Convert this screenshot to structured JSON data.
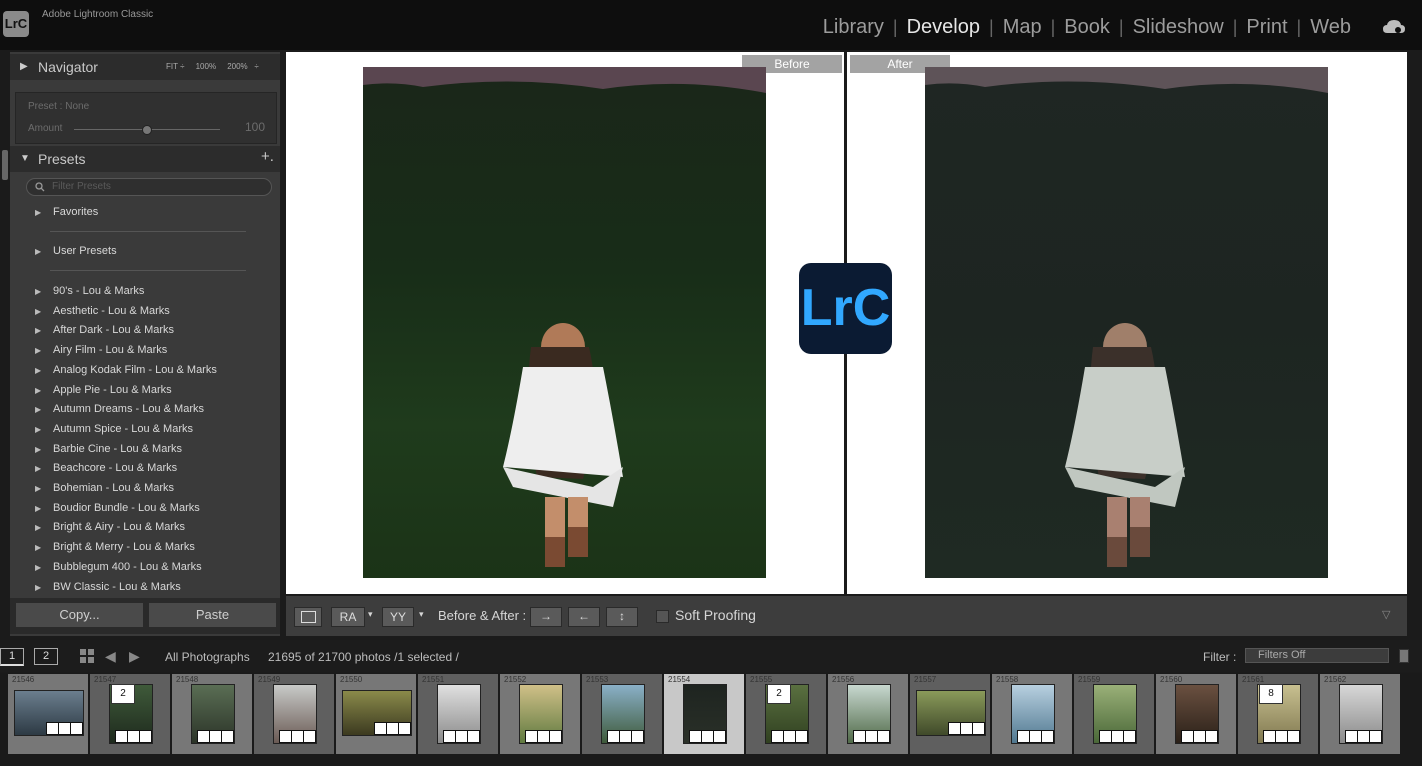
{
  "app": {
    "logo": "LrC",
    "name": "Adobe Lightroom Classic"
  },
  "modules": [
    {
      "label": "Library",
      "active": false
    },
    {
      "label": "Develop",
      "active": true
    },
    {
      "label": "Map",
      "active": false
    },
    {
      "label": "Book",
      "active": false
    },
    {
      "label": "Slideshow",
      "active": false
    },
    {
      "label": "Print",
      "active": false
    },
    {
      "label": "Web",
      "active": false
    }
  ],
  "navigator": {
    "title": "Navigator",
    "zoom": [
      "FIT ÷",
      "100%",
      "200%",
      "÷"
    ]
  },
  "preset_info": {
    "preset_label": "Preset : None",
    "amount_label": "Amount",
    "amount_value": "100",
    "amount_fraction": 0.5
  },
  "presets": {
    "title": "Presets",
    "add": "+.",
    "filter_placeholder": "Filter Presets",
    "groups": [
      "Favorites",
      "User Presets"
    ],
    "items": [
      "90's - Lou & Marks",
      "Aesthetic - Lou & Marks",
      "After Dark - Lou & Marks",
      "Airy Film - Lou & Marks",
      "Analog Kodak Film - Lou & Marks",
      "Apple Pie - Lou & Marks",
      "Autumn Dreams - Lou & Marks",
      "Autumn Spice - Lou & Marks",
      "Barbie Cine - Lou & Marks",
      "Beachcore - Lou & Marks",
      "Bohemian - Lou & Marks",
      "Boudior Bundle - Lou & Marks",
      "Bright & Airy - Lou & Marks",
      "Bright & Merry - Lou & Marks",
      "Bubblegum 400 - Lou & Marks",
      "BW Classic - Lou & Marks"
    ]
  },
  "left_buttons": {
    "copy": "Copy...",
    "paste": "Paste"
  },
  "viewer": {
    "before": "Before",
    "after": "After",
    "badge": "LrC"
  },
  "toolbar": {
    "ba_icon": "RA",
    "yy_icon": "YY",
    "before_after": "Before & After :",
    "soft_proofing": "Soft Proofing"
  },
  "filmstrip_bar": {
    "page1": "1",
    "page2": "2",
    "source": "All Photographs",
    "count": "21695 of 21700 photos /1 selected /",
    "filter_label": "Filter :",
    "filter_value": "Filters Off"
  },
  "filmstrip": [
    {
      "num": "21546",
      "stack": ""
    },
    {
      "num": "21547",
      "stack": "2"
    },
    {
      "num": "21548",
      "stack": ""
    },
    {
      "num": "21549",
      "stack": ""
    },
    {
      "num": "21550",
      "stack": ""
    },
    {
      "num": "21551",
      "stack": ""
    },
    {
      "num": "21552",
      "stack": ""
    },
    {
      "num": "21553",
      "stack": ""
    },
    {
      "num": "21554",
      "stack": ""
    },
    {
      "num": "21555",
      "stack": "2"
    },
    {
      "num": "21556",
      "stack": ""
    },
    {
      "num": "21557",
      "stack": ""
    },
    {
      "num": "21558",
      "stack": ""
    },
    {
      "num": "21559",
      "stack": ""
    },
    {
      "num": "21560",
      "stack": ""
    },
    {
      "num": "21561",
      "stack": "8"
    },
    {
      "num": "21562",
      "stack": ""
    }
  ]
}
